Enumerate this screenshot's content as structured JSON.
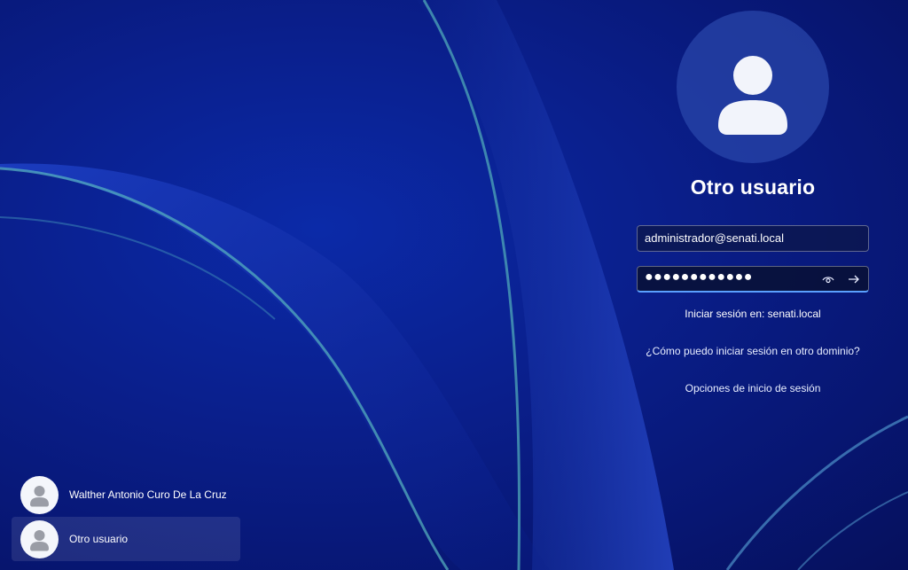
{
  "login": {
    "username_display": "Otro usuario",
    "username_value": "administrador@senati.local",
    "password_mask": "●●●●●●●●●●●●",
    "sign_in_domain": "Iniciar sesión en: senati.local",
    "other_domain_link": "¿Cómo puedo iniciar sesión en otro dominio?",
    "sign_in_options_link": "Opciones de inicio de sesión",
    "icons": {
      "avatar": "user-avatar-icon",
      "reveal": "eye-icon",
      "submit": "arrow-right-icon"
    }
  },
  "user_list": [
    {
      "name": "Walther Antonio Curo De La Cruz",
      "selected": false
    },
    {
      "name": "Otro usuario",
      "selected": true
    }
  ],
  "colors": {
    "background": "#0a1f8c",
    "accent": "#5aa0ff",
    "text": "#ffffff"
  }
}
